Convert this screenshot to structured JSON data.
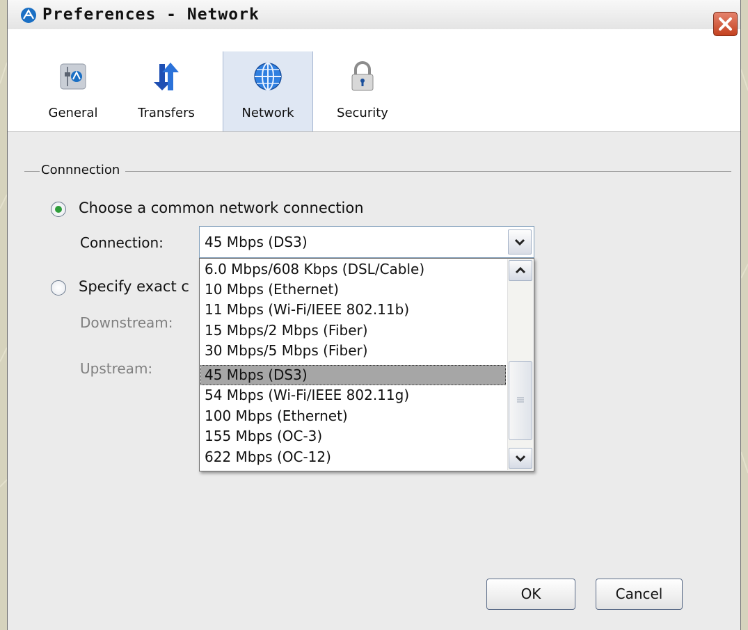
{
  "window": {
    "title": "Preferences - Network"
  },
  "tabs": [
    {
      "label": "General",
      "icon": "general-settings-icon",
      "selected": false
    },
    {
      "label": "Transfers",
      "icon": "transfer-arrows-icon",
      "selected": false
    },
    {
      "label": "Network",
      "icon": "globe-icon",
      "selected": true
    },
    {
      "label": "Security",
      "icon": "padlock-icon",
      "selected": false
    }
  ],
  "connection_group": {
    "legend": "Connnection",
    "radio_common": {
      "label": "Choose a common network connection",
      "checked": true
    },
    "connection_label": "Connection:",
    "connection_value": "45 Mbps (DS3)",
    "radio_exact": {
      "label": "Specify exact c",
      "checked": false
    },
    "downstream_label": "Downstream:",
    "upstream_label": "Upstream:"
  },
  "dropdown": {
    "options": [
      "6.0 Mbps/608 Kbps (DSL/Cable)",
      "10 Mbps (Ethernet)",
      "11 Mbps (Wi-Fi/IEEE 802.11b)",
      "15 Mbps/2 Mbps (Fiber)",
      "30 Mbps/5 Mbps (Fiber)",
      "45 Mbps (DS3)",
      "54 Mbps (Wi-Fi/IEEE 802.11g)",
      "100 Mbps (Ethernet)",
      "155 Mbps (OC-3)",
      "622 Mbps (OC-12)"
    ],
    "selected_index": 5
  },
  "buttons": {
    "ok": "OK",
    "cancel": "Cancel"
  },
  "colors": {
    "selected_tab_bg": "#dfe7f3",
    "radio_dot": "#2e9d3a",
    "highlight": "#a6a6a6",
    "close_button": "#c4411f"
  }
}
